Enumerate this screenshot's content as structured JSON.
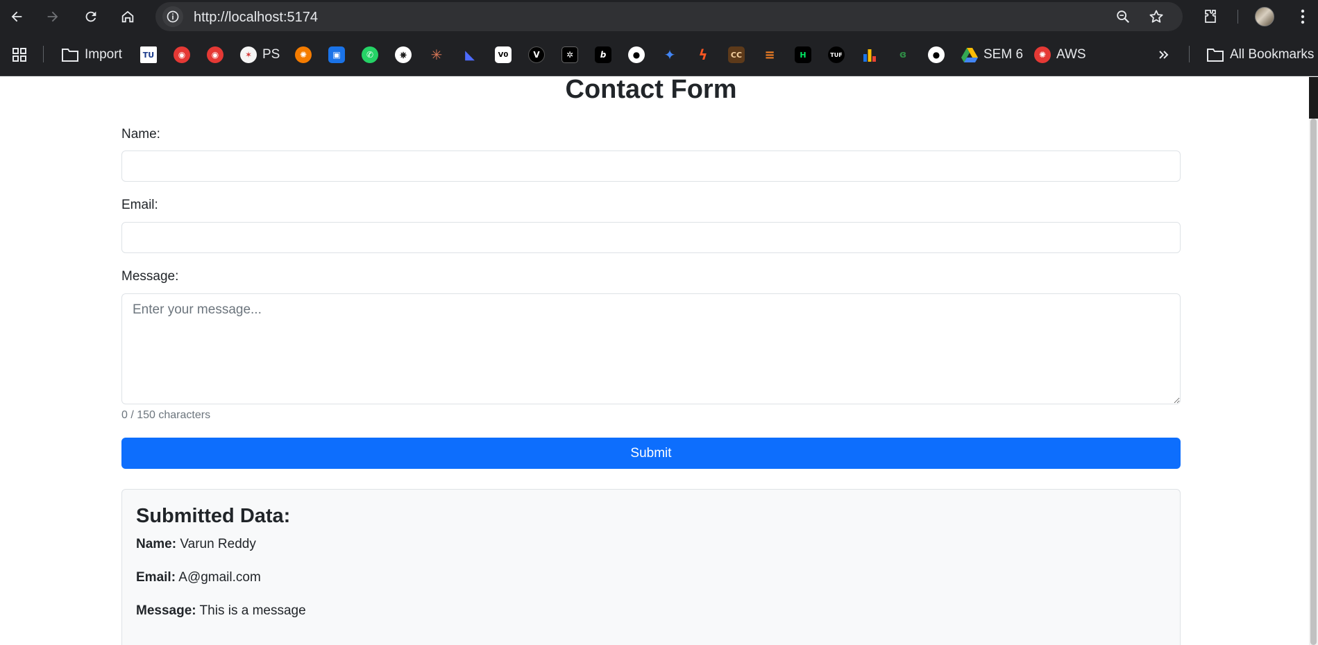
{
  "browser": {
    "url": "http://localhost:5174",
    "bookmarks": [
      {
        "label": "Import",
        "icon": "folder-icon",
        "color": "#202124"
      },
      {
        "label": "",
        "icon": "tu-icon",
        "color": "#ffffff"
      },
      {
        "label": "",
        "icon": "eye-red-icon",
        "color": "#e53935"
      },
      {
        "label": "",
        "icon": "eye-red-icon",
        "color": "#e53935"
      },
      {
        "label": "PS",
        "icon": "ps-star-icon",
        "color": "#e8eaed"
      },
      {
        "label": "",
        "icon": "orange-circle-icon",
        "color": "#f57c00"
      },
      {
        "label": "",
        "icon": "contact-card-icon",
        "color": "#1a73e8"
      },
      {
        "label": "",
        "icon": "whatsapp-icon",
        "color": "#25d366"
      },
      {
        "label": "",
        "icon": "openai-icon",
        "color": "#ffffff"
      },
      {
        "label": "",
        "icon": "claude-icon",
        "color": "#d97757"
      },
      {
        "label": "",
        "icon": "deepseek-icon",
        "color": "#4d6bfe"
      },
      {
        "label": "",
        "icon": "vo-icon",
        "color": "#ffffff"
      },
      {
        "label": "",
        "icon": "v-icon",
        "color": "#000000"
      },
      {
        "label": "",
        "icon": "pattern-icon",
        "color": "#000000"
      },
      {
        "label": "",
        "icon": "b-icon",
        "color": "#000000"
      },
      {
        "label": "",
        "icon": "github-icon",
        "color": "#ffffff"
      },
      {
        "label": "",
        "icon": "gemini-icon",
        "color": "#4285f4"
      },
      {
        "label": "",
        "icon": "bolt-icon",
        "color": "#ff5722"
      },
      {
        "label": "",
        "icon": "cc-icon",
        "color": "#5d3a1a"
      },
      {
        "label": "",
        "icon": "stack-icon",
        "color": "#f48024"
      },
      {
        "label": "",
        "icon": "hackerrank-icon",
        "color": "#00ea64"
      },
      {
        "label": "",
        "icon": "tuf-icon",
        "color": "#000000"
      },
      {
        "label": "",
        "icon": "bar-chart-icon",
        "color": "#fbbc04"
      },
      {
        "label": "",
        "icon": "gfg-icon",
        "color": "#2f8d46"
      },
      {
        "label": "",
        "icon": "github-icon",
        "color": "#ffffff"
      },
      {
        "label": "SEM 6",
        "icon": "drive-icon",
        "color": "#34a853"
      },
      {
        "label": "AWS",
        "icon": "aws-icon",
        "color": "#e53935"
      }
    ],
    "all_bookmarks_label": "All Bookmarks"
  },
  "form": {
    "title": "Contact Form",
    "name_label": "Name:",
    "name_value": "",
    "email_label": "Email:",
    "email_value": "",
    "message_label": "Message:",
    "message_placeholder": "Enter your message...",
    "message_value": "",
    "char_count": "0 / 150 characters",
    "submit_label": "Submit",
    "accent_color": "#0d6efd"
  },
  "submitted": {
    "title": "Submitted Data:",
    "name_label": "Name:",
    "name_value": "Varun Reddy",
    "email_label": "Email:",
    "email_value": "A@gmail.com",
    "message_label": "Message:",
    "message_value": "This is a message"
  }
}
